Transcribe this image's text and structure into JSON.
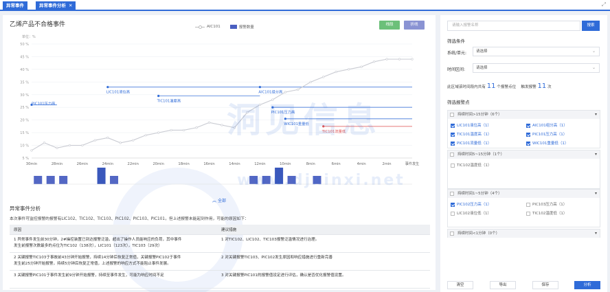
{
  "tabs": [
    {
      "label": "异常事件"
    },
    {
      "label": "异常事件分析"
    }
  ],
  "chart": {
    "title": "乙烯产品不合格事件",
    "btn_line": "线段",
    "btn_fold": "折线",
    "legend_line": "AIC101",
    "legend_bar": "报警数量",
    "y_unit": "单位：%"
  },
  "chart_data": {
    "type": "line",
    "y_ticks": [
      "50 %",
      "45 %",
      "40 %",
      "35 %",
      "30 %",
      "25 %",
      "20 %",
      "15 %",
      "10 %",
      "5 %"
    ],
    "x_ticks": [
      "30min",
      "28min",
      "26min",
      "24min",
      "22min",
      "20min",
      "18min",
      "16min",
      "14min",
      "12min",
      "10min",
      "8min",
      "6min",
      "4min",
      "2min",
      "事件发生"
    ],
    "ylim": [
      5,
      50
    ],
    "series": [
      {
        "name": "AIC101",
        "x": [
          30,
          29,
          28,
          27,
          26,
          25,
          24,
          23,
          22,
          21,
          20,
          19,
          18,
          17,
          16,
          15,
          14,
          13,
          12,
          11,
          10,
          9,
          8,
          7,
          6,
          5,
          4,
          3,
          2,
          1,
          0
        ],
        "values": [
          8,
          11,
          9,
          10,
          10,
          12,
          13,
          11,
          12,
          14,
          15,
          16,
          16,
          17,
          19,
          18,
          17,
          23,
          26,
          28,
          31,
          32,
          35,
          37,
          39,
          40,
          41,
          43,
          44,
          44,
          44
        ]
      }
    ],
    "alarm_lines": [
      {
        "label": "PIC101压力高",
        "color": "#2f6bd8",
        "x_from": 28,
        "x_to": 30
      },
      {
        "label": "LIC101液位高",
        "color": "#2f6bd8",
        "x_from": 24,
        "x_to": 12
      },
      {
        "label": "TIC101温度高",
        "color": "#2f6bd8",
        "x_from": 20,
        "x_to": 12
      },
      {
        "label": "AIC101组分高",
        "color": "#2f6bd8",
        "x_from": 12,
        "x_to": 0
      },
      {
        "label": "PIC101压力高",
        "color": "#2f6bd8",
        "x_from": 11,
        "x_to": 0
      },
      {
        "label": "WIC101重量低",
        "color": "#2f6bd8",
        "x_from": 10,
        "x_to": 0
      },
      {
        "label": "TIC101流量低",
        "color": "#e05555",
        "x_from": 7,
        "x_to": 0
      }
    ],
    "alarm_bars": [
      {
        "x": 29.5,
        "value": 2
      },
      {
        "x": 28.5,
        "value": 2
      },
      {
        "x": 27.5,
        "value": 2
      },
      {
        "x": 24.5,
        "value": 4
      },
      {
        "x": 23.5,
        "value": 2
      },
      {
        "x": 12.5,
        "value": 2
      },
      {
        "x": 11.5,
        "value": 2
      },
      {
        "x": 10.5,
        "value": 4
      },
      {
        "x": 9.5,
        "value": 2
      },
      {
        "x": 7.5,
        "value": 2
      }
    ]
  },
  "expand_label": "︽ 全部",
  "analysis": {
    "title": "异常事件分析",
    "desc": "本次事件可监控报警的报警有LIC102、TIC102、TIC103、PIC102、PIC103、PIC101，但上述报警未能起到作用，可能的原因如下：",
    "col_reason": "原因",
    "col_measure": "建议措施",
    "rows": [
      {
        "reason1": "1 异常事件发生前30分钟，2#操控装置已到达报警泛滥，超出了操作人员能响应的负荷，其中事件",
        "reason2": "发生前报警次数最多的点位为TIC102（138次），LIC101（123次），TIC103（29次）",
        "measure": "1 对TIC102、LIC102、TIC103报警泛滥情况进行治理。"
      },
      {
        "reason1": "2 关键报警TIC103于事故前43分钟开始报警，持续14分钟后恢复正常值，关键报警PIC102于事件",
        "reason2": "发生前25分钟开始报警，持续5分钟后恢复正常值，上述报警的响应方式不能阻止事件发展。",
        "measure": "2 对关键报警TIC103、PIC102发生原因和响应措施进行重新完善"
      },
      {
        "reason1": "3 关键报警PIC101于事件发生前9分钟开始报警，持续至事件发生，可能为响应时间不足",
        "reason2": "",
        "measure": "3 对关键报警PIC101的报警值设定进行评估，确认是否优化报警值设置。"
      }
    ]
  },
  "right": {
    "search_placeholder": "请输入报警名称",
    "search_btn": "搜索",
    "filter_title": "筛选条件",
    "system_label": "系统/单元:",
    "system_value": "请选择",
    "time_label": "时间区间:",
    "time_value": "请选择",
    "stat_prefix": "此区域该时间段内共有",
    "stat_points": "11",
    "stat_points_suffix": "个报警点位",
    "stat_trigger": "触发报警",
    "stat_times": "11",
    "stat_times_suffix": "次",
    "points_title": "筛选报警点",
    "groups": [
      {
        "header": "持续时间>15分钟（6个）",
        "items": [
          "LIC101液位高（1）",
          "AIC101组分高（1）",
          "TIC101温度高（1）",
          "PIC101压力高（1）",
          "PIC101流量低（1）",
          "WIC101重量低（1）"
        ]
      },
      {
        "header": "持续时间5~15分钟（1个）",
        "items": [
          "TIC102温度低（1）"
        ]
      },
      {
        "header": "持续时间1~5分钟（4个）",
        "items": [
          "PIC102压力高（1）",
          "PIC103压力高（1）",
          "LIC102液位低（1）",
          "TIC102温度低（1）"
        ]
      },
      {
        "header": "持续时间<1分钟（0个）",
        "items": []
      }
    ]
  },
  "bottom": {
    "clear": "清空",
    "export": "导出",
    "save": "保存",
    "analyze": "分析"
  },
  "watermark": {
    "brand": "洞见信息",
    "url": "www.djxinxi.net"
  }
}
